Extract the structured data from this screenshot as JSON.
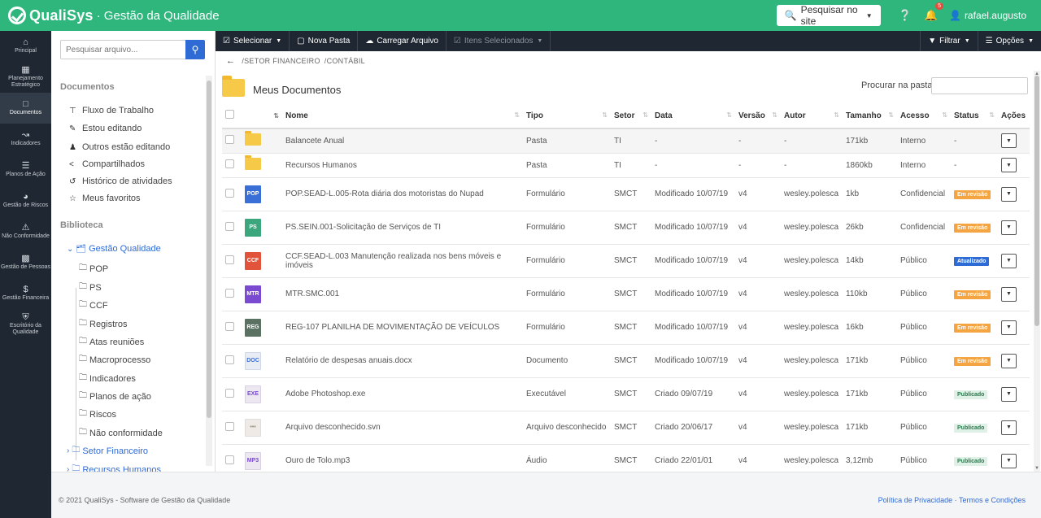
{
  "topbar": {
    "brand": "QualiSys",
    "subtitle": "· Gestão da Qualidade",
    "search_button": "Pesquisar no site",
    "help_icon": "help-icon",
    "notifications_count": "5",
    "username": "rafael.augusto"
  },
  "nav": [
    {
      "label": "Principal",
      "icon": "home-icon"
    },
    {
      "label": "Planejamento Estratégico",
      "icon": "building-icon"
    },
    {
      "label": "Documentos",
      "icon": "file-icon",
      "active": true
    },
    {
      "label": "Indicadores",
      "icon": "chart-icon"
    },
    {
      "label": "Planos de Ação",
      "icon": "list-icon"
    },
    {
      "label": "Gestão de Riscos",
      "icon": "gauge-icon"
    },
    {
      "label": "Não Conformidade",
      "icon": "alert-icon"
    },
    {
      "label": "Gestão de Pessoas",
      "icon": "clipboard-icon"
    },
    {
      "label": "Gestão Financeira",
      "icon": "dollar-icon"
    },
    {
      "label": "Escritório da Qualidade",
      "icon": "shield-icon"
    }
  ],
  "filepane": {
    "search_placeholder": "Pesquisar arquivo...",
    "documents_title": "Documentos",
    "documents": [
      {
        "label": "Fluxo de Trabalho",
        "icon": "workflow-icon"
      },
      {
        "label": "Estou editando",
        "icon": "user-edit-icon"
      },
      {
        "label": "Outros estão editando",
        "icon": "users-icon"
      },
      {
        "label": "Compartilhados",
        "icon": "share-icon"
      },
      {
        "label": "Histórico de atividades",
        "icon": "history-icon"
      },
      {
        "label": "Meus favoritos",
        "icon": "star-icon"
      }
    ],
    "library_title": "Biblioteca",
    "library_root": "Gestão Qualidade",
    "library_children": [
      "POP",
      "PS",
      "CCF",
      "Registros",
      "Atas reuniões",
      "Macroprocesso",
      "Indicadores",
      "Planos de ação",
      "Riscos",
      "Não conformidade"
    ],
    "library_siblings": [
      "Setor Financeiro",
      "Recursos Humanos"
    ]
  },
  "toolbar": {
    "select": "Selecionar",
    "new_folder": "Nova Pasta",
    "upload": "Carregar Arquivo",
    "selected_items": "Itens Selecionados",
    "filter": "Filtrar",
    "options": "Opções"
  },
  "breadcrumb": [
    "/SETOR FINANCEIRO",
    "/CONTÁBIL"
  ],
  "main": {
    "title": "Meus Documentos",
    "search_label": "Procurar na pasta",
    "columns": [
      "Nome",
      "Tipo",
      "Setor",
      "Data",
      "Versão",
      "Autor",
      "Tamanho",
      "Acesso",
      "Status",
      "Ações"
    ],
    "rows": [
      {
        "icon": "folder",
        "name": "Balancete Anual",
        "type": "Pasta",
        "sector": "TI",
        "date": "-",
        "version": "-",
        "author": "-",
        "size": "171kb",
        "access": "Interno",
        "status": "-",
        "status_kind": "none"
      },
      {
        "icon": "folder",
        "name": "Recursos Humanos",
        "type": "Pasta",
        "sector": "TI",
        "date": "-",
        "version": "-",
        "author": "-",
        "size": "1860kb",
        "access": "Interno",
        "status": "-",
        "status_kind": "none"
      },
      {
        "icon": "pop",
        "icon_label": "POP",
        "name": "POP.SEAD-L.005-Rota diária dos motoristas do Nupad",
        "type": "Formulário",
        "sector": "SMCT",
        "date": "Modificado 10/07/19",
        "version": "v4",
        "author": "wesley.polesca",
        "size": "1kb",
        "access": "Confidencial",
        "status": "Em revisão",
        "status_kind": "rev"
      },
      {
        "icon": "ps",
        "icon_label": "PS",
        "name": "PS.SEIN.001-Solicitação de Serviços de TI",
        "type": "Formulário",
        "sector": "SMCT",
        "date": "Modificado 10/07/19",
        "version": "v4",
        "author": "wesley.polesca",
        "size": "26kb",
        "access": "Confidencial",
        "status": "Em revisão",
        "status_kind": "rev"
      },
      {
        "icon": "ccf",
        "icon_label": "CCF",
        "name": "CCF.SEAD-L.003 Manutenção realizada nos bens móveis e imóveis",
        "type": "Formulário",
        "sector": "SMCT",
        "date": "Modificado 10/07/19",
        "version": "v4",
        "author": "wesley.polesca",
        "size": "14kb",
        "access": "Público",
        "status": "Atualizado",
        "status_kind": "upd"
      },
      {
        "icon": "mtr",
        "icon_label": "MTR",
        "name": "MTR.SMC.001",
        "type": "Formulário",
        "sector": "SMCT",
        "date": "Modificado 10/07/19",
        "version": "v4",
        "author": "wesley.polesca",
        "size": "110kb",
        "access": "Público",
        "status": "Em revisão",
        "status_kind": "rev"
      },
      {
        "icon": "reg",
        "icon_label": "REG",
        "name": "REG-107 PLANILHA DE MOVIMENTAÇÃO DE VEÍCULOS",
        "type": "Formulário",
        "sector": "SMCT",
        "date": "Modificado 10/07/19",
        "version": "v4",
        "author": "wesley.polesca",
        "size": "16kb",
        "access": "Público",
        "status": "Em revisão",
        "status_kind": "rev"
      },
      {
        "icon": "doc",
        "icon_label": "DOC",
        "name": "Relatório de despesas anuais.docx",
        "type": "Documento",
        "sector": "SMCT",
        "date": "Modificado 10/07/19",
        "version": "v4",
        "author": "wesley.polesca",
        "size": "171kb",
        "access": "Público",
        "status": "Em revisão",
        "status_kind": "rev"
      },
      {
        "icon": "exe",
        "icon_label": "EXE",
        "name": "Adobe Photoshop.exe",
        "type": "Executável",
        "sector": "SMCT",
        "date": "Criado 09/07/19",
        "version": "v4",
        "author": "wesley.polesca",
        "size": "171kb",
        "access": "Público",
        "status": "Publicado",
        "status_kind": "pub"
      },
      {
        "icon": "unk",
        "icon_label": "•••",
        "name": "Arquivo desconhecido.svn",
        "type": "Arquivo desconhecido",
        "sector": "SMCT",
        "date": "Criado 20/06/17",
        "version": "v4",
        "author": "wesley.polesca",
        "size": "171kb",
        "access": "Público",
        "status": "Publicado",
        "status_kind": "pub"
      },
      {
        "icon": "mp3",
        "icon_label": "MP3",
        "name": "Ouro de Tolo.mp3",
        "type": "Áudio",
        "sector": "SMCT",
        "date": "Criado 22/01/01",
        "version": "v4",
        "author": "wesley.polesca",
        "size": "3,12mb",
        "access": "Público",
        "status": "Publicado",
        "status_kind": "pub"
      }
    ]
  },
  "footer": {
    "copyright": "© 2021 QualiSys - Software de Gestão da Qualidade",
    "links": "Política de Privacidade · Termos e Condições"
  }
}
